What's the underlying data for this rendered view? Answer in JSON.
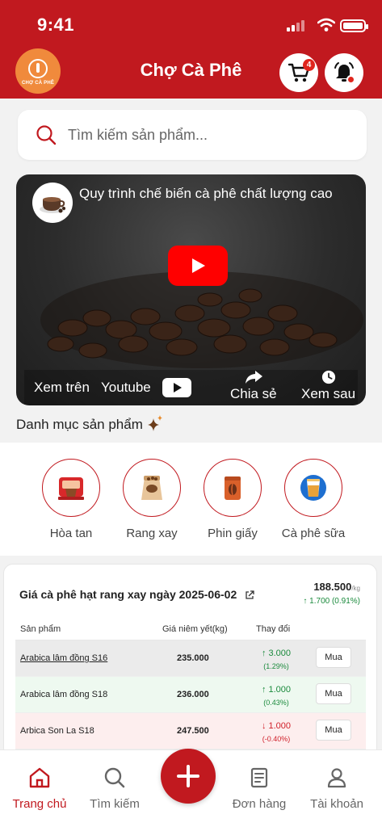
{
  "status_bar": {
    "time": "9:41"
  },
  "header": {
    "title": "Chợ Cà Phê",
    "logo_text": "CHỢ CÀ PHÊ",
    "cart_badge": "4",
    "brand_color": "#c1191f"
  },
  "search": {
    "placeholder": "Tìm kiếm sản phẩm..."
  },
  "video": {
    "title": "Quy trình chế biến cà phê chất lượng cao",
    "watch_on": "Xem trên",
    "youtube": "Youtube",
    "share": "Chia sẻ",
    "watch_later": "Xem sau"
  },
  "categories": {
    "title": "Danh mục sản phẩm",
    "items": [
      {
        "label": "Hòa tan",
        "icon": "instant-coffee-icon"
      },
      {
        "label": "Rang xay",
        "icon": "coffee-bag-icon"
      },
      {
        "label": "Phin giấy",
        "icon": "drip-bag-icon"
      },
      {
        "label": "Cà phê sữa",
        "icon": "milk-coffee-icon"
      }
    ]
  },
  "price_card": {
    "title": "Giá cà phê hạt rang xay ngày 2025-06-02",
    "price": "188.500",
    "unit": "/kg",
    "change": "↑ 1.700 (0.91%)",
    "columns": [
      "Sản phẩm",
      "Giá niêm yết(kg)",
      "Thay đổi"
    ],
    "buy_label": "Mua",
    "rows": [
      {
        "name": "Arabica lâm đồng S16",
        "price": "235.000",
        "change": "↑ 3.000",
        "pct": "(1.29%)",
        "dir": "up",
        "bg": "#ebebeb"
      },
      {
        "name": "Arabica lâm đồng S18",
        "price": "236.000",
        "change": "↑ 1.000",
        "pct": "(0.43%)",
        "dir": "up",
        "bg": "#eef9f0"
      },
      {
        "name": "Arbica Son La S18",
        "price": "247.500",
        "change": "↓ 1.000",
        "pct": "(-0.40%)",
        "dir": "down",
        "bg": "#fdeeee"
      }
    ]
  },
  "bottom_nav": {
    "items": [
      {
        "label": "Trang chủ",
        "icon": "home-icon",
        "active": true
      },
      {
        "label": "Tìm kiếm",
        "icon": "search-icon"
      },
      {
        "label": "Đơn hàng",
        "icon": "orders-icon"
      },
      {
        "label": "Tài khoản",
        "icon": "account-icon"
      }
    ]
  }
}
